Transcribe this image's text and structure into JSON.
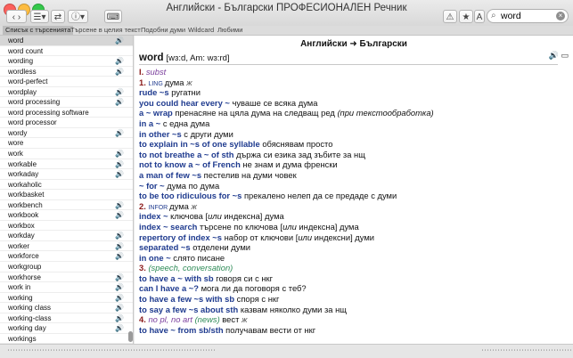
{
  "window": {
    "title": "Английски - Български ПРОФЕСИОНАЛЕН Речник"
  },
  "toolbar": {
    "search_value": "word"
  },
  "tabs": [
    {
      "label": "Списък с търсенията"
    },
    {
      "label": "Търсене в целия текст"
    },
    {
      "label": "Подобни думи"
    },
    {
      "label": "Wildcard"
    },
    {
      "label": "Любими"
    }
  ],
  "list": [
    {
      "word": "word",
      "audio": true
    },
    {
      "word": "word count",
      "audio": false
    },
    {
      "word": "wording",
      "audio": true
    },
    {
      "word": "wordless",
      "audio": true
    },
    {
      "word": "word-perfect",
      "audio": false
    },
    {
      "word": "wordplay",
      "audio": true
    },
    {
      "word": "word processing",
      "audio": true
    },
    {
      "word": "word processing software",
      "audio": false
    },
    {
      "word": "word processor",
      "audio": false
    },
    {
      "word": "wordy",
      "audio": true
    },
    {
      "word": "wore",
      "audio": false
    },
    {
      "word": "work",
      "audio": true
    },
    {
      "word": "workable",
      "audio": true
    },
    {
      "word": "workaday",
      "audio": true
    },
    {
      "word": "workaholic",
      "audio": false
    },
    {
      "word": "workbasket",
      "audio": false
    },
    {
      "word": "workbench",
      "audio": true
    },
    {
      "word": "workbook",
      "audio": true
    },
    {
      "word": "workbox",
      "audio": false
    },
    {
      "word": "workday",
      "audio": true
    },
    {
      "word": "worker",
      "audio": true
    },
    {
      "word": "workforce",
      "audio": true
    },
    {
      "word": "workgroup",
      "audio": false
    },
    {
      "word": "workhorse",
      "audio": true
    },
    {
      "word": "work in",
      "audio": true
    },
    {
      "word": "working",
      "audio": true
    },
    {
      "word": "working class",
      "audio": true
    },
    {
      "word": "working-class",
      "audio": true
    },
    {
      "word": "working day",
      "audio": true
    },
    {
      "word": "workings",
      "audio": false
    }
  ],
  "entry": {
    "direction": "Английски ➜ Български",
    "headword": "word",
    "transcription": "[wɜ:d, Am: wɜ:rd]",
    "lines": [
      [
        {
          "t": "I. ",
          "c": "num"
        },
        {
          "t": "subst",
          "c": "it"
        }
      ],
      [
        {
          "t": "1. ",
          "c": "num"
        },
        {
          "t": "LING ",
          "c": "lbl"
        },
        {
          "t": "дума "
        },
        {
          "t": "ж",
          "c": "g"
        }
      ],
      [
        {
          "t": "rude ~s",
          "c": "ex"
        },
        {
          "t": " ругатни"
        }
      ],
      [
        {
          "t": "you could hear every ~",
          "c": "ex"
        },
        {
          "t": " чуваше се всяка дума"
        }
      ],
      [
        {
          "t": "a ~ wrap",
          "c": "ex"
        },
        {
          "t": " пренасяне на цяла дума на следващ ред "
        },
        {
          "t": "(при текстообработка)",
          "c": "i"
        }
      ],
      [
        {
          "t": "in a ~",
          "c": "ex"
        },
        {
          "t": " с една дума"
        }
      ],
      [
        {
          "t": "in other ~s",
          "c": "ex"
        },
        {
          "t": " с други думи"
        }
      ],
      [
        {
          "t": "to explain in ~s of one syllable",
          "c": "ex"
        },
        {
          "t": " обяснявам просто"
        }
      ],
      [
        {
          "t": "to not breathe a ~ of sth",
          "c": "ex"
        },
        {
          "t": " държа си езика зад зъбите за нщ"
        }
      ],
      [
        {
          "t": "not to know a ~ of French",
          "c": "ex"
        },
        {
          "t": " не знам и дума френски"
        }
      ],
      [
        {
          "t": "a man of few ~s",
          "c": "ex"
        },
        {
          "t": " пестелив на думи човек"
        }
      ],
      [
        {
          "t": "~ for ~",
          "c": "ex"
        },
        {
          "t": " дума по дума"
        }
      ],
      [
        {
          "t": "to be too ridiculous for ~s",
          "c": "ex"
        },
        {
          "t": " прекалено нелеп да се предаде с думи"
        }
      ],
      [
        {
          "t": "2. ",
          "c": "num"
        },
        {
          "t": "INFOR ",
          "c": "lbl"
        },
        {
          "t": "дума "
        },
        {
          "t": "ж",
          "c": "g"
        }
      ],
      [
        {
          "t": "index ~",
          "c": "ex"
        },
        {
          "t": " ключова ["
        },
        {
          "t": "или",
          "c": "i"
        },
        {
          "t": " индексна] дума"
        }
      ],
      [
        {
          "t": "index ~ search",
          "c": "ex"
        },
        {
          "t": " търсене по ключова ["
        },
        {
          "t": "или",
          "c": "i"
        },
        {
          "t": " индексна] дума"
        }
      ],
      [
        {
          "t": "repertory of index ~s",
          "c": "ex"
        },
        {
          "t": " набор от ключови ["
        },
        {
          "t": "или",
          "c": "i"
        },
        {
          "t": " индексни] думи"
        }
      ],
      [
        {
          "t": "separated ~s",
          "c": "ex"
        },
        {
          "t": " отделени думи"
        }
      ],
      [
        {
          "t": "in one ~",
          "c": "ex"
        },
        {
          "t": " слято писане"
        }
      ],
      [
        {
          "t": "3. ",
          "c": "num"
        },
        {
          "t": "(speech, conversation)",
          "c": "gr"
        }
      ],
      [
        {
          "t": "to have a ~ with sb",
          "c": "ex"
        },
        {
          "t": " говоря си с нкг"
        }
      ],
      [
        {
          "t": "can I have a ~?",
          "c": "ex"
        },
        {
          "t": " мога ли да поговоря с теб?"
        }
      ],
      [
        {
          "t": "to have a few ~s with sb",
          "c": "ex"
        },
        {
          "t": " споря с нкг"
        }
      ],
      [
        {
          "t": "to say a few ~s about sth",
          "c": "ex"
        },
        {
          "t": " казвам няколко думи за нщ"
        }
      ],
      [
        {
          "t": "4. ",
          "c": "num"
        },
        {
          "t": "no pl, no art ",
          "c": "it"
        },
        {
          "t": "(news)",
          "c": "gr"
        },
        {
          "t": " вест "
        },
        {
          "t": "ж",
          "c": "g"
        }
      ],
      [
        {
          "t": "to have ~ from sb/sth",
          "c": "ex"
        },
        {
          "t": " получавам вести от нкг"
        }
      ]
    ]
  }
}
